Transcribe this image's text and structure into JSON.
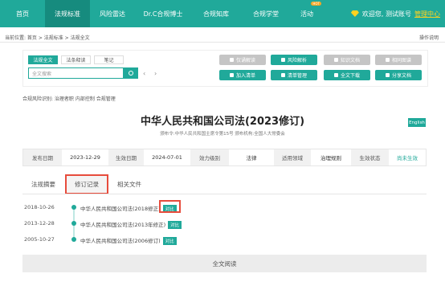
{
  "nav": {
    "items": [
      {
        "label": "首页"
      },
      {
        "label": "法规标准"
      },
      {
        "label": "风险雷达"
      },
      {
        "label": "Dr.C合规博士"
      },
      {
        "label": "合规知库"
      },
      {
        "label": "合规学堂"
      },
      {
        "label": "活动"
      }
    ],
    "hot_badge": "HOT",
    "welcome": "欢迎您, 测试账号",
    "admin_link": "管理中心"
  },
  "breadcrumb": "当前位置:  首页 > 法规标准 > 法规全文",
  "help": "操作说明",
  "tabs": [
    "法规全文",
    "法条释读",
    "笔记"
  ],
  "search": {
    "placeholder": "全文搜索"
  },
  "actions": {
    "row1": [
      "仅诵解读",
      "风险解析",
      "知识文档",
      "相同图谱"
    ],
    "row2": [
      "加入清单",
      "清单管理",
      "全文下载",
      "分享文档"
    ]
  },
  "tags": "合规风险识别:  治理者职  内部控制  合规管理",
  "title": "中华人民共和国公司法(2023修订)",
  "meta": "颁布令:中华人民共和国主席令第15号  颁布机构:全国人大常委会",
  "english": "English",
  "info": {
    "publish_label": "发布日期",
    "publish_value": "2023-12-29",
    "effective_label": "生效日期",
    "effective_value": "2024-07-01",
    "level_label": "效力级别",
    "level_value": "法律",
    "scope_label": "适用领域",
    "scope_value": "治理规则",
    "status_label": "生效状态",
    "status_value": "尚未生效"
  },
  "subtabs": [
    "法规摘要",
    "修订记录",
    "相关文件"
  ],
  "revisions": [
    {
      "date": "2018-10-26",
      "title": "中华人民共和国公司法(2018修正)",
      "compare": "对比"
    },
    {
      "date": "2013-12-28",
      "title": "中华人民共和国公司法(2013年修正)",
      "compare": "对比"
    },
    {
      "date": "2005-10-27",
      "title": "中华人民共和国公司法(2006修订)",
      "compare": "对比"
    }
  ],
  "full_read": "全文阅读",
  "colors": {
    "primary": "#20a99a",
    "highlight": "#e74c3c",
    "gold": "#ffd21f"
  }
}
